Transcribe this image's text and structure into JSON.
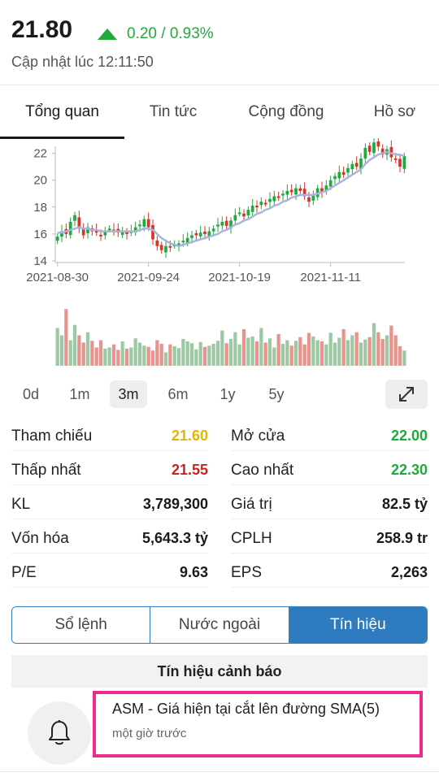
{
  "quote": {
    "price": "21.80",
    "change": "0.20 / 0.93%",
    "updated": "Cập nhật lúc 12:11:50",
    "up_color": "#1faa3c"
  },
  "tabs": [
    {
      "label": "Tổng quan",
      "active": true
    },
    {
      "label": "Tin tức",
      "active": false
    },
    {
      "label": "Cộng đồng",
      "active": false
    },
    {
      "label": "Hồ sơ",
      "active": false
    }
  ],
  "chart_data": {
    "type": "candlestick",
    "y_ticks": [
      "22",
      "20",
      "18",
      "16",
      "14"
    ],
    "x_ticks": [
      "2021-08-30",
      "2021-09-24",
      "2021-10-19",
      "2021-11-11"
    ],
    "ylim": [
      14,
      23
    ],
    "series": [
      {
        "name": "",
        "type": "candlestick",
        "values": [
          15.8,
          16.2,
          16.0,
          16.9,
          17.4,
          16.4,
          15.9,
          16.5,
          16.2,
          16.1,
          15.9,
          16.2,
          16.4,
          16.3,
          16.1,
          16.2,
          16.0,
          16.2,
          16.5,
          16.7,
          17.1,
          16.5,
          15.6,
          15.1,
          14.8,
          15.1,
          15.0,
          15.2,
          15.3,
          15.5,
          15.7,
          15.9,
          15.9,
          16.1,
          16.0,
          16.2,
          16.4,
          16.7,
          16.9,
          16.6,
          17.0,
          17.4,
          17.6,
          17.3,
          17.8,
          18.1,
          18.0,
          18.4,
          18.3,
          18.6,
          18.8,
          18.7,
          19.0,
          19.2,
          19.1,
          19.4,
          19.2,
          18.8,
          18.4,
          18.9,
          19.4,
          19.1,
          19.6,
          20.0,
          20.3,
          20.6,
          20.4,
          20.9,
          21.2,
          21.0,
          21.6,
          22.4,
          22.1,
          22.8,
          22.5,
          21.9,
          22.3,
          21.7,
          21.5,
          21.0,
          21.8
        ]
      },
      {
        "name": "",
        "type": "line",
        "values": [
          16.1,
          16.1,
          16.2,
          16.3,
          16.4,
          16.5,
          16.4,
          16.4,
          16.3,
          16.3,
          16.2,
          16.2,
          16.2,
          16.2,
          16.2,
          16.2,
          16.2,
          16.2,
          16.2,
          16.3,
          16.4,
          16.4,
          16.3,
          16.0,
          15.7,
          15.5,
          15.3,
          15.2,
          15.1,
          15.2,
          15.3,
          15.4,
          15.5,
          15.6,
          15.7,
          15.8,
          15.9,
          16.0,
          16.2,
          16.3,
          16.5,
          16.7,
          16.8,
          17.0,
          17.1,
          17.3,
          17.5,
          17.6,
          17.8,
          17.9,
          18.1,
          18.2,
          18.4,
          18.5,
          18.7,
          18.8,
          18.9,
          18.9,
          18.9,
          18.9,
          19.0,
          19.1,
          19.2,
          19.4,
          19.6,
          19.8,
          20.0,
          20.2,
          20.4,
          20.6,
          20.8,
          21.2,
          21.5,
          21.7,
          21.9,
          22.0,
          22.1,
          22.0,
          21.9,
          21.9,
          21.8
        ]
      },
      {
        "name": "",
        "type": "bar",
        "values": [
          0.62,
          0.5,
          0.93,
          0.42,
          0.67,
          0.5,
          0.38,
          0.55,
          0.41,
          0.3,
          0.42,
          0.28,
          0.3,
          0.35,
          0.26,
          0.4,
          0.28,
          0.3,
          0.45,
          0.38,
          0.33,
          0.31,
          0.25,
          0.42,
          0.36,
          0.22,
          0.35,
          0.32,
          0.29,
          0.44,
          0.4,
          0.37,
          0.27,
          0.39,
          0.31,
          0.33,
          0.36,
          0.41,
          0.58,
          0.37,
          0.44,
          0.55,
          0.35,
          0.6,
          0.46,
          0.48,
          0.4,
          0.62,
          0.38,
          0.45,
          0.3,
          0.52,
          0.36,
          0.42,
          0.33,
          0.41,
          0.47,
          0.35,
          0.54,
          0.48,
          0.42,
          0.4,
          0.35,
          0.54,
          0.38,
          0.46,
          0.6,
          0.42,
          0.5,
          0.55,
          0.38,
          0.43,
          0.47,
          0.7,
          0.55,
          0.44,
          0.5,
          0.66,
          0.5,
          0.32,
          0.25
        ]
      }
    ],
    "up_color": "#1faa3c",
    "down_color": "#d9342b",
    "ma_color": "#a9b4dc"
  },
  "periods": [
    {
      "label": "0d",
      "active": false
    },
    {
      "label": "1m",
      "active": false
    },
    {
      "label": "3m",
      "active": true
    },
    {
      "label": "6m",
      "active": false
    },
    {
      "label": "1y",
      "active": false
    },
    {
      "label": "5y",
      "active": false
    }
  ],
  "stats": {
    "left": [
      {
        "label": "Tham chiếu",
        "value": "21.60",
        "color": "#e6b400"
      },
      {
        "label": "Thấp nhất",
        "value": "21.55",
        "color": "#c9241f"
      },
      {
        "label": "KL",
        "value": "3,789,300",
        "color": "#1a1a1a"
      },
      {
        "label": "Vốn hóa",
        "value": "5,643.3 tỷ",
        "color": "#1a1a1a"
      },
      {
        "label": "P/E",
        "value": "9.63",
        "color": "#1a1a1a"
      }
    ],
    "right": [
      {
        "label": "Mở cửa",
        "value": "22.00",
        "color": "#1faa3c"
      },
      {
        "label": "Cao nhất",
        "value": "22.30",
        "color": "#1faa3c"
      },
      {
        "label": "Giá trị",
        "value": "82.5 tỷ",
        "color": "#1a1a1a"
      },
      {
        "label": "CPLH",
        "value": "258.9 tr",
        "color": "#1a1a1a"
      },
      {
        "label": "EPS",
        "value": "2,263",
        "color": "#1a1a1a"
      }
    ]
  },
  "segments": [
    {
      "label": "Sổ lệnh",
      "active": false
    },
    {
      "label": "Nước ngoài",
      "active": false
    },
    {
      "label": "Tín hiệu",
      "active": true
    }
  ],
  "signals": {
    "header": "Tín hiệu cảnh báo",
    "items": [
      {
        "title": "ASM - Giá hiện tại cắt lên đường SMA(5)",
        "time": "một giờ trước",
        "icon": "bell-icon"
      }
    ]
  }
}
